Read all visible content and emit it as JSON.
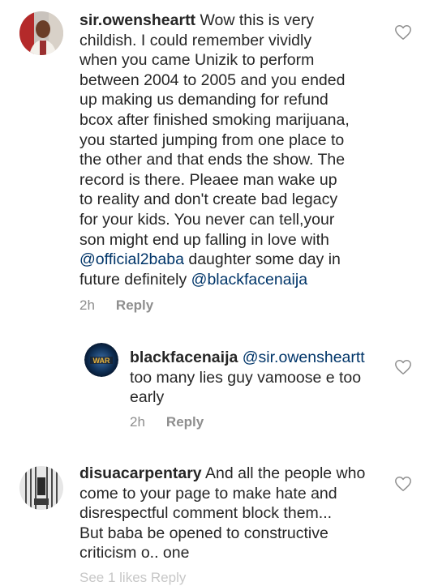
{
  "comments": [
    {
      "username": "sir.owensheartt",
      "lines": [
        "Wow this is very",
        "childish. I could remember vividly",
        "when you came Unizik to perform",
        "between 2004 to 2005 and you ended",
        "up making us demanding for refund",
        "bcox after finished smoking marijuana,",
        "you started jumping from one place to",
        "the other and that ends the show. The",
        "record is there. Pleaee man wake up",
        "to reality and don't create bad legacy",
        "for your kids. You never can tell,your",
        "son might end up falling in love with"
      ],
      "mention1": "@official2baba",
      "line13_rest": " daughter some day in",
      "line14_start": "future definitely ",
      "mention2": "@blackfacenaija",
      "time": "2h",
      "reply_label": "Reply"
    },
    {
      "username": "blackfacenaija",
      "mention": "@sir.owensheartt",
      "lines": [
        "too many lies guy vamoose e too",
        "early"
      ],
      "time": "2h",
      "reply_label": "Reply",
      "avatar_text": "WAR"
    },
    {
      "username": "disuacarpentary",
      "lines": [
        "And all the people who",
        "come to your page to make hate and",
        "disrespectful comment block them...",
        "But baba be opened to constructive",
        "criticism o.. one"
      ]
    }
  ],
  "footer_cutoff": "See 1 likes Reply"
}
